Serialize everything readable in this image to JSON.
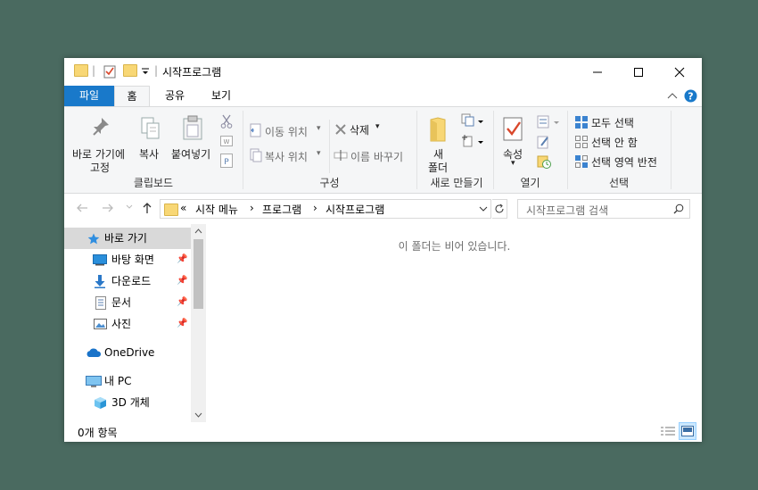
{
  "window": {
    "title": "시작프로그램",
    "quick_access_sep": "|"
  },
  "tabs": [
    {
      "label": "파일"
    },
    {
      "label": "홈"
    },
    {
      "label": "공유"
    },
    {
      "label": "보기"
    }
  ],
  "ribbon": {
    "clipboard": {
      "pin_label_1": "바로 가기에",
      "pin_label_2": "고정",
      "copy_label": "복사",
      "paste_label": "붙여넣기",
      "group": "클립보드"
    },
    "organize": {
      "move_to": "이동 위치",
      "copy_to": "복사 위치",
      "delete": "삭제",
      "rename": "이름 바꾸기",
      "group": "구성"
    },
    "new": {
      "new_folder_1": "새",
      "new_folder_2": "폴더",
      "group": "새로 만들기"
    },
    "open": {
      "properties": "속성",
      "group": "열기"
    },
    "select": {
      "select_all": "모두 선택",
      "select_none": "선택 안 함",
      "invert": "선택 영역 반전",
      "group": "선택"
    }
  },
  "address": {
    "prefix": "«",
    "crumbs": [
      "시작 메뉴",
      "프로그램",
      "시작프로그램"
    ],
    "sep": "›",
    "search_placeholder": "시작프로그램 검색"
  },
  "nav": {
    "items": [
      {
        "label": "바로 가기",
        "icon": "star-icon"
      },
      {
        "label": "바탕 화면",
        "icon": "desktop-icon",
        "pinned": true
      },
      {
        "label": "다운로드",
        "icon": "download-icon",
        "pinned": true
      },
      {
        "label": "문서",
        "icon": "document-icon",
        "pinned": true
      },
      {
        "label": "사진",
        "icon": "pictures-icon",
        "pinned": true
      },
      {
        "label": "OneDrive",
        "icon": "cloud-icon"
      },
      {
        "label": "내 PC",
        "icon": "pc-icon"
      },
      {
        "label": "3D 개체",
        "icon": "cube-icon"
      }
    ]
  },
  "content": {
    "empty_message": "이 폴더는 비어 있습니다."
  },
  "status": {
    "count": "0개 항목"
  },
  "colors": {
    "accent": "#1979ca",
    "folder": "#f8d775"
  }
}
